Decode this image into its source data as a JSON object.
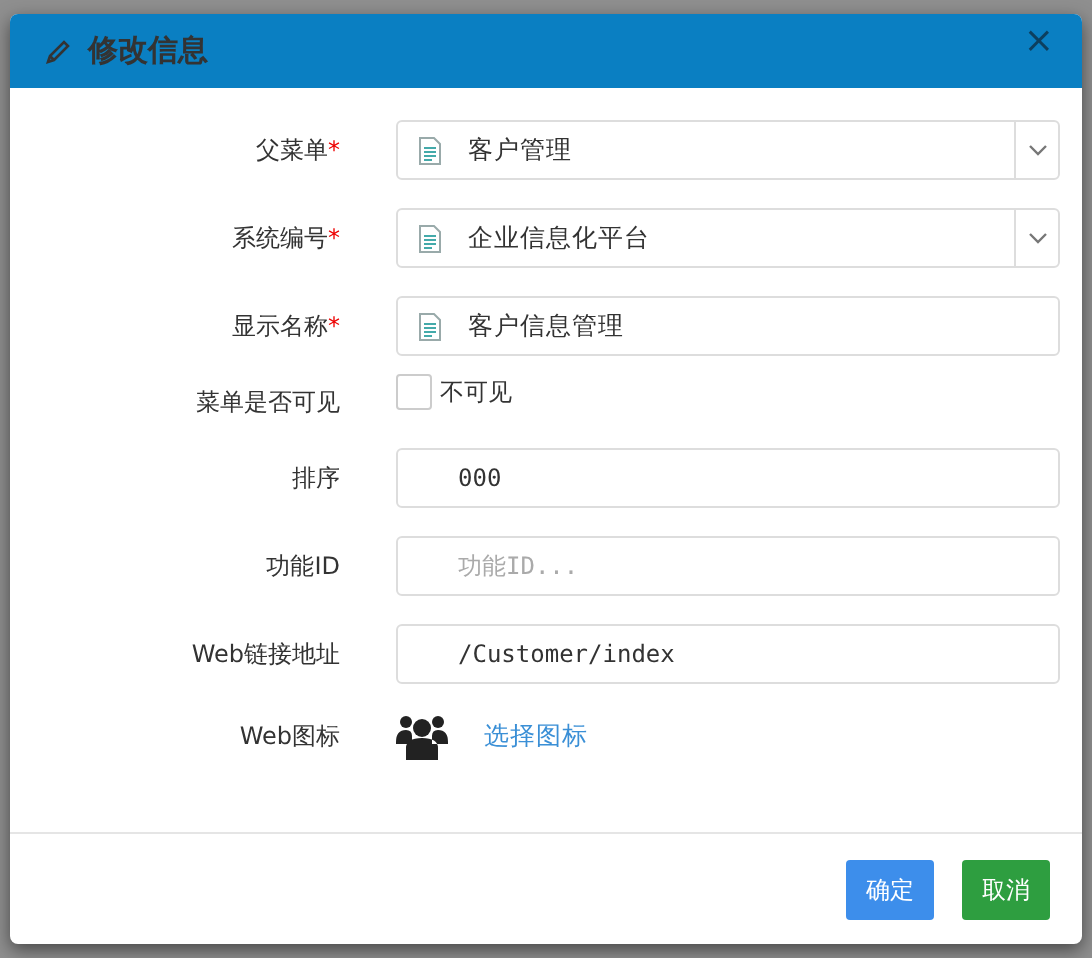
{
  "dialog": {
    "title": "修改信息",
    "close": "×",
    "fields": [
      {
        "kind": "select",
        "label": "父菜单",
        "required_mark": "*",
        "value": "客户管理"
      },
      {
        "kind": "select",
        "label": "系统编号",
        "required_mark": "*",
        "value": "企业信息化平台"
      },
      {
        "kind": "icon-text",
        "label": "显示名称",
        "required_mark": "*",
        "value": "客户信息管理"
      },
      {
        "kind": "checkbox",
        "label": "菜单是否可见",
        "option": "不可见",
        "checked": false
      },
      {
        "kind": "text",
        "label": "排序",
        "value": "000"
      },
      {
        "kind": "text",
        "label": "功能ID",
        "placeholder": "功能ID..."
      },
      {
        "kind": "text",
        "label": "Web链接地址",
        "value": "/Customer/index"
      },
      {
        "kind": "icon-picker",
        "label": "Web图标",
        "link": "选择图标"
      }
    ],
    "buttons": [
      {
        "label": "确定",
        "kind": "primary"
      },
      {
        "label": "取消",
        "kind": "success"
      }
    ]
  }
}
